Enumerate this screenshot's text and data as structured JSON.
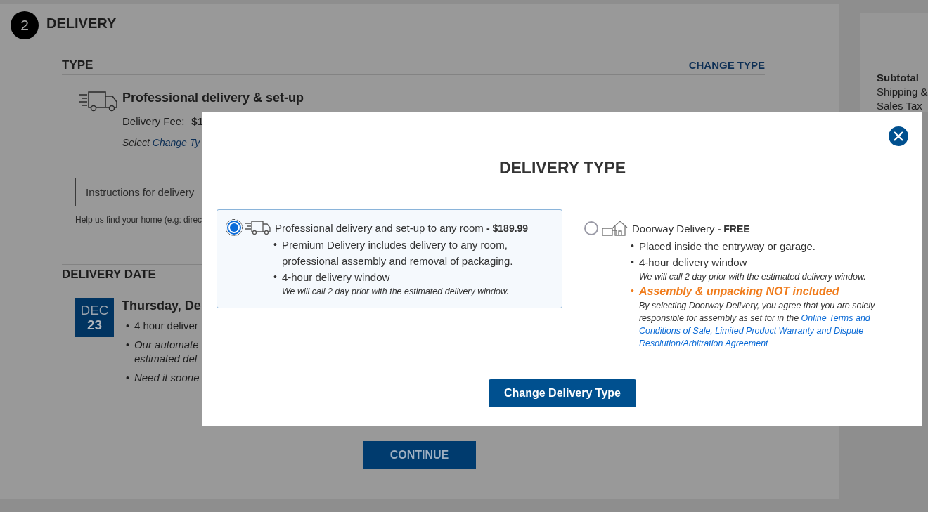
{
  "step": {
    "number": "2",
    "title": "DELIVERY"
  },
  "type_section": {
    "heading": "TYPE",
    "change_link": "CHANGE TYPE",
    "selected_type": "Professional delivery & set-up",
    "fee_label": "Delivery Fee:",
    "fee_value": "$1",
    "note": "Select ",
    "note_link": "Change Ty"
  },
  "instructions": {
    "placeholder": "Instructions for delivery",
    "help": "Help us find your home (e.g: direc"
  },
  "date_section": {
    "heading": "DELIVERY DATE",
    "month": "DEC",
    "day": "23",
    "date": "Thursday, De",
    "bullets": [
      {
        "kind": "plain",
        "marker": "•",
        "lines": [
          "4 hour deliver"
        ]
      },
      {
        "kind": "note",
        "marker": "•",
        "lines": [
          "Our automate",
          "estimated del"
        ]
      },
      {
        "kind": "note",
        "marker": "•",
        "lines": [
          "Need it soone"
        ]
      }
    ]
  },
  "continue_button": "CONTINUE",
  "summary": {
    "rows": [
      "Subtotal",
      "Shipping &",
      "Sales Tax"
    ]
  },
  "modal": {
    "title": "DELIVERY TYPE",
    "options": [
      {
        "selected": true,
        "name": "Professional delivery and set-up to any room",
        "price": "- $189.99",
        "bullets": [
          {
            "kind": "plain",
            "marker": "•",
            "text": "Premium Delivery includes delivery to any room, professional assembly and removal of packaging."
          },
          {
            "kind": "plain",
            "marker": "•",
            "text": "4-hour delivery window",
            "note": "We will call 2 day prior with the estimated delivery window."
          }
        ]
      },
      {
        "selected": false,
        "name": "Doorway Delivery",
        "price": "- FREE",
        "bullets": [
          {
            "kind": "plain",
            "marker": "•",
            "text": "Placed inside the entryway or garage."
          },
          {
            "kind": "plain",
            "marker": "•",
            "text": "4-hour delivery window",
            "note": "We will call 2 day prior with the estimated delivery window."
          },
          {
            "kind": "warning",
            "marker": "•",
            "text": "Assembly & unpacking NOT included",
            "note": "By selecting Doorway Delivery, you agree that you are solely responsible for assembly as set for in the",
            "note_links": [
              "Online Terms and",
              "Conditions of Sale, Limited Product Warranty and Dispute Resolution/Arbitration Agreement"
            ]
          }
        ]
      }
    ],
    "button": "Change Delivery Type"
  }
}
